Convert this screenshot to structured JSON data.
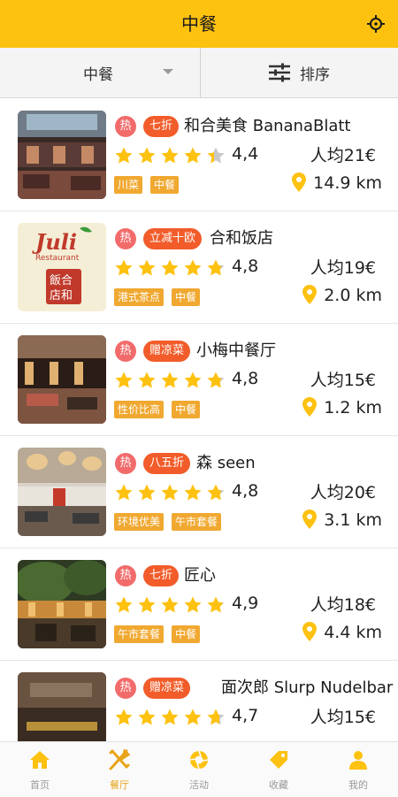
{
  "header": {
    "title": "中餐",
    "location_icon": "location-target-icon"
  },
  "filters": {
    "category": "中餐",
    "sort": "排序"
  },
  "labels": {
    "hot": "热",
    "avg_prefix": "人均"
  },
  "colors": {
    "accent": "#FDC110",
    "hot_badge": "#F26B6B",
    "promo_badge": "#F25C2A",
    "tag": "#F0A830",
    "star": "#FDC110"
  },
  "restaurants": [
    {
      "name": "和合美食 BananaBlatt",
      "promo": "七折",
      "stars": 4.4,
      "rating": "4,4",
      "price": "人均21€",
      "tags": [
        "川菜",
        "中餐"
      ],
      "distance": "14.9 km"
    },
    {
      "name": "合和饭店",
      "promo": "立减十欧",
      "stars": 4.8,
      "rating": "4,8",
      "price": "人均19€",
      "tags": [
        "港式茶点",
        "中餐"
      ],
      "distance": "2.0 km"
    },
    {
      "name": "小梅中餐厅",
      "promo": "赠凉菜",
      "stars": 4.8,
      "rating": "4,8",
      "price": "人均15€",
      "tags": [
        "性价比高",
        "中餐"
      ],
      "distance": "1.2 km"
    },
    {
      "name": "森 seen",
      "promo": "八五折",
      "stars": 4.8,
      "rating": "4,8",
      "price": "人均20€",
      "tags": [
        "环境优美",
        "午市套餐"
      ],
      "distance": "3.1 km"
    },
    {
      "name": "匠心",
      "promo": "七折",
      "stars": 4.9,
      "rating": "4,9",
      "price": "人均18€",
      "tags": [
        "午市套餐",
        "中餐"
      ],
      "distance": "4.4 km"
    },
    {
      "name": "面次郎 Slurp Nudelbar",
      "promo": "赠凉菜",
      "stars": 4.7,
      "rating": "4,7",
      "price": "人均15€",
      "tags": [
        "",
        ""
      ],
      "distance": ""
    }
  ],
  "logo_text": {
    "script": "Juli",
    "sub": "Restaurant",
    "seal": "飯合店和"
  },
  "tabs": [
    {
      "label": "首页",
      "icon": "home-icon",
      "active": false
    },
    {
      "label": "餐厅",
      "icon": "fork-knife-icon",
      "active": true
    },
    {
      "label": "活动",
      "icon": "camera-aperture-icon",
      "active": false
    },
    {
      "label": "收藏",
      "icon": "tag-icon",
      "active": false
    },
    {
      "label": "我的",
      "icon": "user-icon",
      "active": false
    }
  ]
}
